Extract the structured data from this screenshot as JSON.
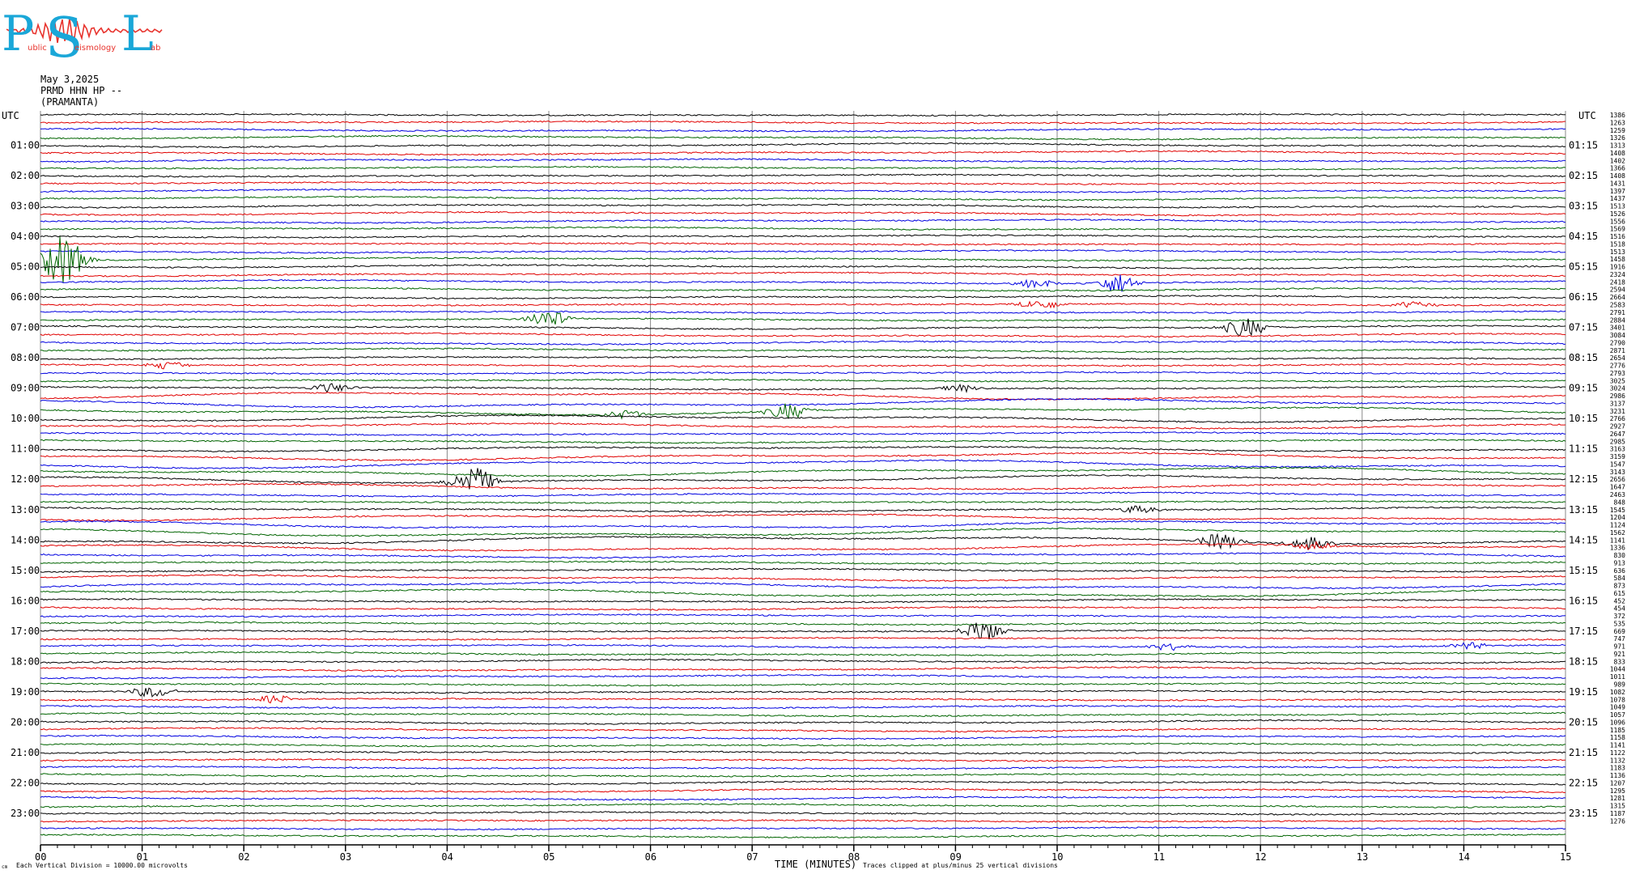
{
  "logo": {
    "letters": [
      "P",
      "S",
      "L"
    ],
    "subtext": [
      "ublic",
      "eismology",
      "ab"
    ],
    "colors": {
      "letters": "#1aa7d8",
      "wave": "#e8342e"
    }
  },
  "header": {
    "date": "May 3,2025",
    "station": "PRMD HHN HP --",
    "site": "(PRAMANTA)"
  },
  "axes": {
    "left_title": "UTC",
    "right_title": "UTC",
    "xlabel": "TIME (MINUTES)",
    "footer_left": "Each Vertical Division = 10000.00 microvolts",
    "footer_right": "Traces clipped at plus/minus 25 vertical divisions",
    "corner_mark": "cm"
  },
  "chart_data": {
    "type": "line",
    "title": "",
    "xlabel": "TIME (MINUTES)",
    "xlim": [
      0,
      15
    ],
    "x_ticks": [
      "00",
      "01",
      "02",
      "03",
      "04",
      "05",
      "06",
      "07",
      "08",
      "09",
      "10",
      "11",
      "12",
      "13",
      "14",
      "15"
    ],
    "traces_per_hour": 4,
    "trace_count": 96,
    "trace_colors": [
      "#000000",
      "#e00000",
      "#0000e0",
      "#006400"
    ],
    "left_labels": [
      {
        "trace": 4,
        "text": "01:00"
      },
      {
        "trace": 8,
        "text": "02:00"
      },
      {
        "trace": 12,
        "text": "03:00"
      },
      {
        "trace": 16,
        "text": "04:00"
      },
      {
        "trace": 20,
        "text": "05:00"
      },
      {
        "trace": 24,
        "text": "06:00"
      },
      {
        "trace": 28,
        "text": "07:00"
      },
      {
        "trace": 32,
        "text": "08:00"
      },
      {
        "trace": 36,
        "text": "09:00"
      },
      {
        "trace": 40,
        "text": "10:00"
      },
      {
        "trace": 44,
        "text": "11:00"
      },
      {
        "trace": 48,
        "text": "12:00"
      },
      {
        "trace": 52,
        "text": "13:00"
      },
      {
        "trace": 56,
        "text": "14:00"
      },
      {
        "trace": 60,
        "text": "15:00"
      },
      {
        "trace": 64,
        "text": "16:00"
      },
      {
        "trace": 68,
        "text": "17:00"
      },
      {
        "trace": 72,
        "text": "18:00"
      },
      {
        "trace": 76,
        "text": "19:00"
      },
      {
        "trace": 80,
        "text": "20:00"
      },
      {
        "trace": 84,
        "text": "21:00"
      },
      {
        "trace": 88,
        "text": "22:00"
      },
      {
        "trace": 92,
        "text": "23:00"
      }
    ],
    "right_labels": [
      {
        "trace": 4,
        "text": "01:15"
      },
      {
        "trace": 8,
        "text": "02:15"
      },
      {
        "trace": 12,
        "text": "03:15"
      },
      {
        "trace": 16,
        "text": "04:15"
      },
      {
        "trace": 20,
        "text": "05:15"
      },
      {
        "trace": 24,
        "text": "06:15"
      },
      {
        "trace": 28,
        "text": "07:15"
      },
      {
        "trace": 32,
        "text": "08:15"
      },
      {
        "trace": 36,
        "text": "09:15"
      },
      {
        "trace": 40,
        "text": "10:15"
      },
      {
        "trace": 44,
        "text": "11:15"
      },
      {
        "trace": 48,
        "text": "12:15"
      },
      {
        "trace": 52,
        "text": "13:15"
      },
      {
        "trace": 56,
        "text": "14:15"
      },
      {
        "trace": 60,
        "text": "15:15"
      },
      {
        "trace": 64,
        "text": "16:15"
      },
      {
        "trace": 68,
        "text": "17:15"
      },
      {
        "trace": 72,
        "text": "18:15"
      },
      {
        "trace": 76,
        "text": "19:15"
      },
      {
        "trace": 80,
        "text": "20:15"
      },
      {
        "trace": 84,
        "text": "21:15"
      },
      {
        "trace": 88,
        "text": "22:15"
      },
      {
        "trace": 92,
        "text": "23:15"
      }
    ],
    "trace_values": [
      "1386",
      "1263",
      "1259",
      "1326",
      "1313",
      "1408",
      "1402",
      "1366",
      "1408",
      "1431",
      "1397",
      "1437",
      "1513",
      "1526",
      "1556",
      "1569",
      "1516",
      "1518",
      "1513",
      "1458",
      "1916",
      "2324",
      "2418",
      "2594",
      "2664",
      "2583",
      "2791",
      "2884",
      "3401",
      "3084",
      "2790",
      "2871",
      "2654",
      "2776",
      "2793",
      "3025",
      "3024",
      "2986",
      "3137",
      "3231",
      "2766",
      "2927",
      "2647",
      "2985",
      "3163",
      "3159",
      "1547",
      "3143",
      "2656",
      "1647",
      "2463",
      "848",
      "1545",
      "1204",
      "1124",
      "1562",
      "1141",
      "1336",
      "830",
      "913",
      "636",
      "584",
      "873",
      "615",
      "452",
      "454",
      "372",
      "535",
      "669",
      "747",
      "971",
      "921",
      "833",
      "1044",
      "1011",
      "989",
      "1082",
      "1078",
      "1049",
      "1057",
      "1096",
      "1185",
      "1158",
      "1141",
      "1122",
      "1132",
      "1183",
      "1136",
      "1207",
      "1295",
      "1281",
      "1315",
      "1187",
      "1276"
    ],
    "events": [
      {
        "trace": 19,
        "minute": 0.22,
        "amp": 3.5
      },
      {
        "trace": 22,
        "minute": 10.6,
        "amp": 1.3
      },
      {
        "trace": 22,
        "minute": 9.8,
        "amp": 0.6
      },
      {
        "trace": 25,
        "minute": 9.85,
        "amp": 0.7
      },
      {
        "trace": 25,
        "minute": 13.5,
        "amp": 0.5
      },
      {
        "trace": 27,
        "minute": 5.0,
        "amp": 1.2
      },
      {
        "trace": 28,
        "minute": 11.85,
        "amp": 1.3
      },
      {
        "trace": 33,
        "minute": 1.25,
        "amp": 0.5
      },
      {
        "trace": 36,
        "minute": 2.85,
        "amp": 0.6
      },
      {
        "trace": 36,
        "minute": 9.05,
        "amp": 0.5
      },
      {
        "trace": 39,
        "minute": 7.35,
        "amp": 1.1
      },
      {
        "trace": 39,
        "minute": 5.75,
        "amp": 0.6
      },
      {
        "trace": 48,
        "minute": 4.25,
        "amp": 2.2
      },
      {
        "trace": 52,
        "minute": 10.8,
        "amp": 0.6
      },
      {
        "trace": 56,
        "minute": 11.6,
        "amp": 1.1
      },
      {
        "trace": 56,
        "minute": 12.45,
        "amp": 0.9
      },
      {
        "trace": 57,
        "minute": 12.5,
        "amp": 0.5
      },
      {
        "trace": 68,
        "minute": 9.25,
        "amp": 1.5
      },
      {
        "trace": 70,
        "minute": 11.1,
        "amp": 0.5
      },
      {
        "trace": 70,
        "minute": 14.05,
        "amp": 0.5
      },
      {
        "trace": 76,
        "minute": 1.1,
        "amp": 0.8
      },
      {
        "trace": 77,
        "minute": 2.3,
        "amp": 0.6
      }
    ]
  }
}
